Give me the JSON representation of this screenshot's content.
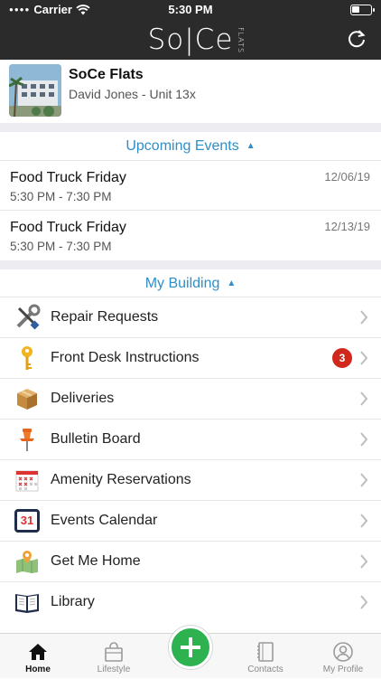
{
  "status_bar": {
    "carrier": "Carrier",
    "time": "5:30 PM"
  },
  "header": {
    "logo": "So|Ce",
    "logo_sub": "FLATS"
  },
  "property": {
    "name": "SoCe Flats",
    "resident": "David Jones - Unit 13x"
  },
  "events_section": {
    "title": "Upcoming Events",
    "items": [
      {
        "title": "Food Truck Friday",
        "time": "5:30 PM - 7:30 PM",
        "date": "12/06/19"
      },
      {
        "title": "Food Truck Friday",
        "time": "5:30 PM - 7:30 PM",
        "date": "12/13/19"
      }
    ]
  },
  "building_section": {
    "title": "My Building",
    "items": [
      {
        "label": "Repair Requests",
        "icon": "tools-icon"
      },
      {
        "label": "Front Desk Instructions",
        "icon": "key-icon",
        "badge": "3"
      },
      {
        "label": "Deliveries",
        "icon": "package-icon"
      },
      {
        "label": "Bulletin Board",
        "icon": "pushpin-icon"
      },
      {
        "label": "Amenity Reservations",
        "icon": "calendar-grid-icon"
      },
      {
        "label": "Events Calendar",
        "icon": "calendar-31-icon",
        "icon_text": "31"
      },
      {
        "label": "Get Me Home",
        "icon": "map-icon"
      },
      {
        "label": "Library",
        "icon": "book-icon"
      }
    ]
  },
  "tab_bar": {
    "tabs": [
      {
        "label": "Home",
        "icon": "home-icon",
        "active": true
      },
      {
        "label": "Lifestyle",
        "icon": "bag-icon"
      },
      {
        "label": "Contacts",
        "icon": "contacts-icon"
      },
      {
        "label": "My Profile",
        "icon": "profile-icon"
      }
    ]
  },
  "colors": {
    "accent": "#2f8fc8",
    "header_bg": "#2b2b2b",
    "fab": "#2eb14f",
    "badge": "#d0281c"
  }
}
